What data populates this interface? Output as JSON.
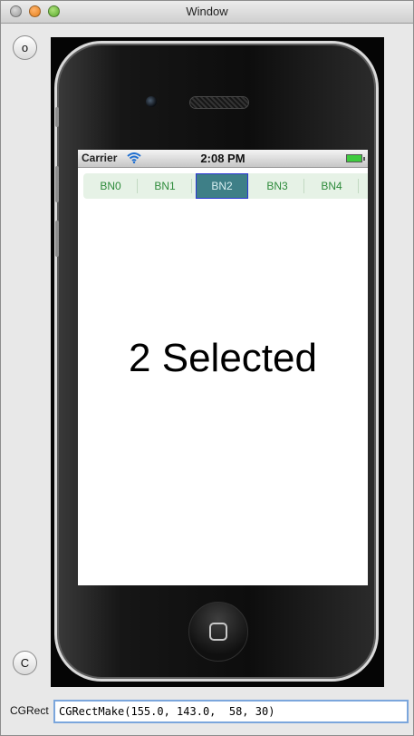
{
  "window": {
    "title": "Window",
    "close_icon": "close-traffic-light",
    "minimize_icon": "minimize-traffic-light",
    "zoom_icon": "zoom-traffic-light"
  },
  "side_controls": {
    "top_button_label": "o",
    "bottom_button_label": "C"
  },
  "phone": {
    "status_bar": {
      "carrier": "Carrier",
      "wifi_icon": "wifi-icon",
      "time": "2:08 PM",
      "battery_icon": "battery-full-icon"
    },
    "tabs": [
      {
        "label": "BN0",
        "selected": false
      },
      {
        "label": "BN1",
        "selected": false
      },
      {
        "label": "BN2",
        "selected": true
      },
      {
        "label": "BN3",
        "selected": false
      },
      {
        "label": "BN4",
        "selected": false
      }
    ],
    "selected_text": "2 Selected",
    "home_icon": "home-button-icon"
  },
  "footer": {
    "label": "CGRect",
    "value": "CGRectMake(155.0, 143.0,  58, 30)"
  },
  "colors": {
    "tab_text": "#2e8b3b",
    "tab_background": "#e6f2e6",
    "selected_tab_background": "#3e7f87",
    "selected_tab_border": "#2a36d4"
  }
}
